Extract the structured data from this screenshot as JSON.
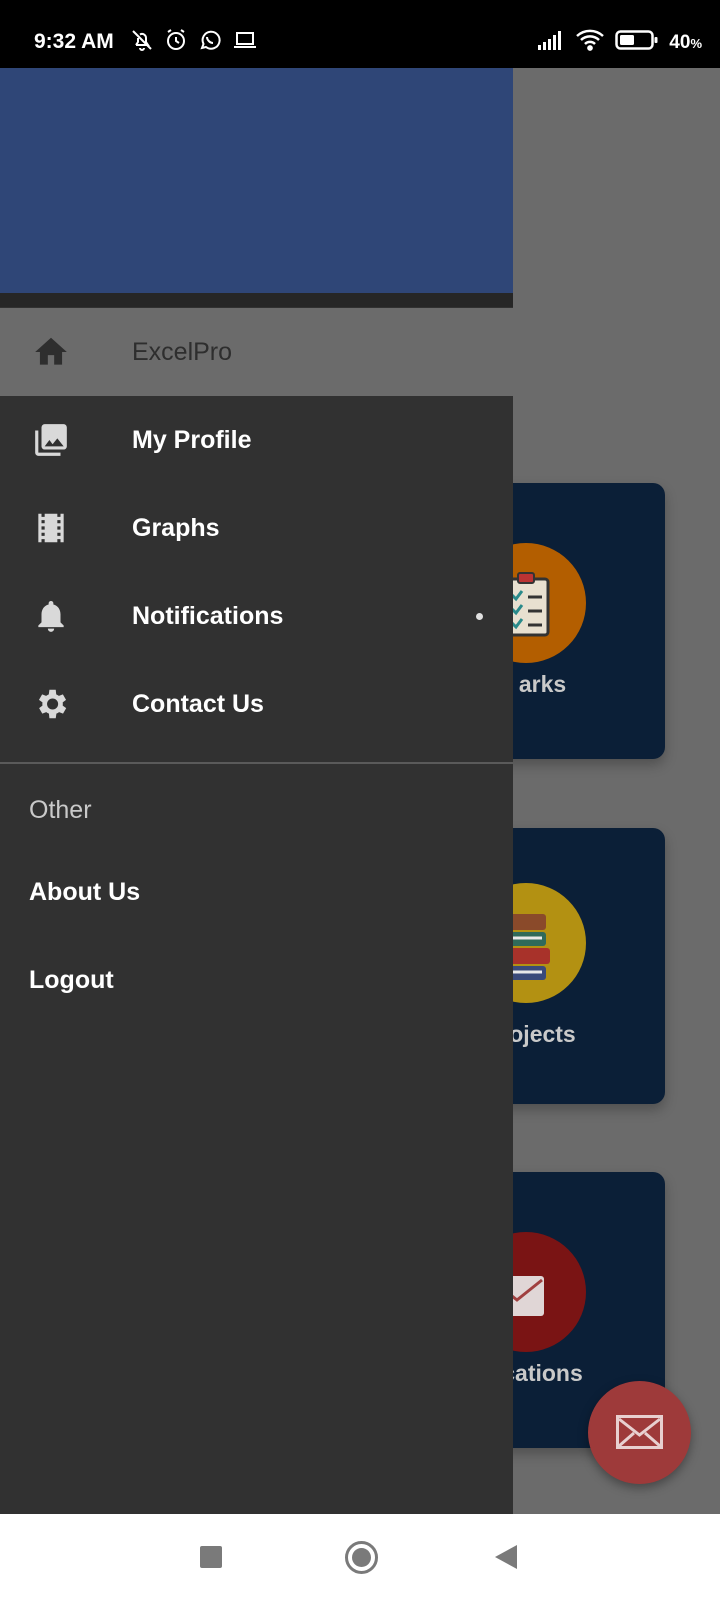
{
  "status_bar": {
    "time": "9:32 AM",
    "battery_level": "40",
    "battery_unit": "%",
    "left_icons": [
      "bell-off-icon",
      "alarm-icon",
      "whatsapp-icon",
      "laptop-icon"
    ],
    "right_icons": [
      "signal-icon",
      "wifi-icon",
      "battery-icon"
    ]
  },
  "drawer": {
    "header_color": "#2f4677",
    "items": [
      {
        "label": "ExcelPro",
        "icon": "home-icon",
        "active": true
      },
      {
        "label": "My Profile",
        "icon": "photo-library-icon",
        "active": false
      },
      {
        "label": "Graphs",
        "icon": "film-icon",
        "active": false
      },
      {
        "label": "Notifications",
        "icon": "bell-icon",
        "active": false,
        "indicator_dot": true
      },
      {
        "label": "Contact Us",
        "icon": "gear-icon",
        "active": false
      }
    ],
    "section_title": "Other",
    "other_items": [
      {
        "label": "About Us"
      },
      {
        "label": "Logout"
      }
    ]
  },
  "background_app": {
    "cards": [
      {
        "label": "arks",
        "icon": "clipboard-icon",
        "circle_color": "#b35e00"
      },
      {
        "label": "ojects",
        "icon": "books-icon",
        "circle_color": "#b39112"
      },
      {
        "label": "cations",
        "icon": "envelope-icon",
        "circle_color": "#7a1414"
      }
    ],
    "fab_icon": "mail-icon"
  },
  "nav_bar": {
    "buttons": [
      "recent-apps-button",
      "home-button",
      "back-button"
    ]
  }
}
